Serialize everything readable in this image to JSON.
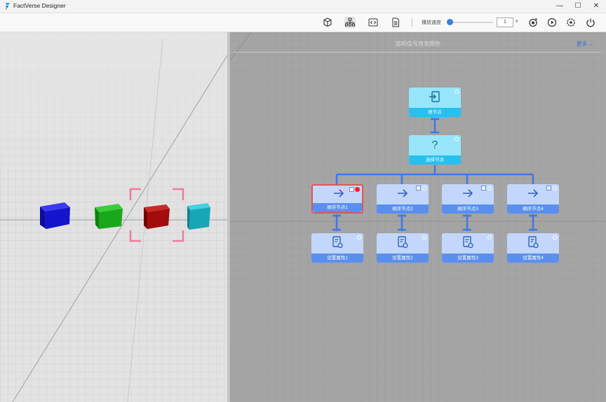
{
  "window": {
    "title": "FactVerse Designer",
    "minimize_glyph": "—",
    "maximize_glyph": "☐",
    "close_glyph": "✕"
  },
  "toolbar": {
    "icons": [
      "cube-icon",
      "tree-icon",
      "code-icon",
      "document-icon"
    ],
    "speed_label": "播放速度",
    "speed_value": "1",
    "speed_unit": "x",
    "speed_slider_fraction": 0.0,
    "right_icons": [
      "record-icon",
      "play-icon",
      "settings-icon",
      "power-icon"
    ]
  },
  "scene": {
    "cubes": [
      {
        "name": "blue-cube",
        "color": "#1a1ae0"
      },
      {
        "name": "green-cube",
        "color": "#1bb21b"
      },
      {
        "name": "red-cube",
        "color": "#b31010",
        "selected": true
      },
      {
        "name": "cyan-cube",
        "color": "#18b4c8"
      }
    ],
    "selection_color": "#f07a9a"
  },
  "behavior_tree": {
    "title": "监听信号改变颜色",
    "more_label": "更多",
    "nodes": {
      "root": {
        "label": "根节点",
        "icon": "enter-icon"
      },
      "selector": {
        "label": "选择节点",
        "icon": "question-icon"
      },
      "sequences": [
        {
          "label": "顺序节点1",
          "icon": "arrow-right-icon",
          "selected": true
        },
        {
          "label": "顺序节点2",
          "icon": "arrow-right-icon"
        },
        {
          "label": "顺序节点3",
          "icon": "arrow-right-icon"
        },
        {
          "label": "顺序节点4",
          "icon": "arrow-right-icon"
        }
      ],
      "actions": [
        {
          "label": "设置属性1",
          "icon": "property-settings-icon"
        },
        {
          "label": "设置属性2",
          "icon": "property-settings-icon"
        },
        {
          "label": "设置属性3",
          "icon": "property-settings-icon"
        },
        {
          "label": "设置属性4",
          "icon": "property-settings-icon"
        }
      ]
    },
    "colors": {
      "connector": "#3f77e6",
      "cyan_node": "#97e6fa",
      "blue_node": "#c3d7fd",
      "selected_border": "#e55353"
    }
  }
}
